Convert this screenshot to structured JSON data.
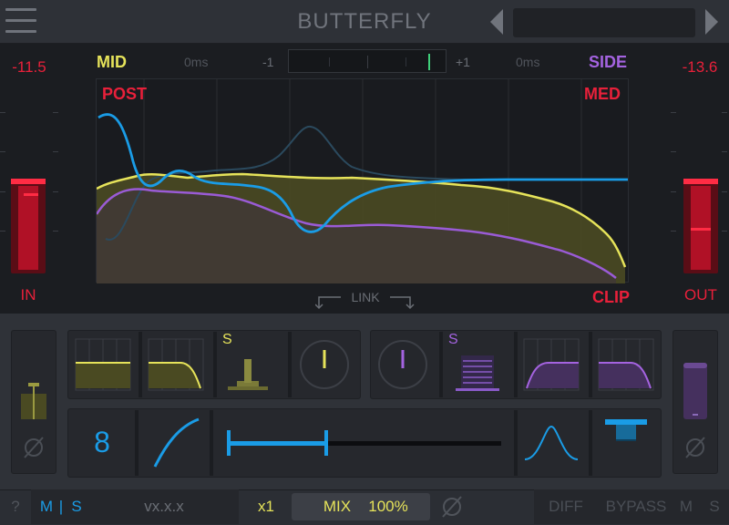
{
  "header": {
    "title": "BUTTERFLY",
    "preset_name": ""
  },
  "meters": {
    "in": {
      "value": "-11.5",
      "label": "IN",
      "level": 0.55
    },
    "out": {
      "value": "-13.6",
      "label": "OUT",
      "level": 0.55
    }
  },
  "graph": {
    "mid_label": "MID",
    "side_label": "SIDE",
    "post_label": "POST",
    "med_label": "MED",
    "clip_label": "CLIP",
    "mid_delay": "0ms",
    "side_delay": "0ms",
    "balance_min": "-1",
    "balance_max": "+1",
    "link_label": "LINK"
  },
  "mid_panel": {
    "solo_label": "S"
  },
  "side_panel": {
    "solo_label": "S"
  },
  "lower_row": {
    "order_value": "8"
  },
  "footer": {
    "help": "?",
    "ms_m": "M",
    "ms_sep": "|",
    "ms_s": "S",
    "version": "vx.x.x",
    "oversample": "x1",
    "mix_label": "MIX",
    "mix_value": "100%",
    "diff": "DIFF",
    "bypass": "BYPASS",
    "m": "M",
    "s": "S"
  },
  "colors": {
    "mid": "#e6e35a",
    "side": "#a463e0",
    "accent_blue": "#1a9ce6",
    "red": "#e8203a"
  }
}
